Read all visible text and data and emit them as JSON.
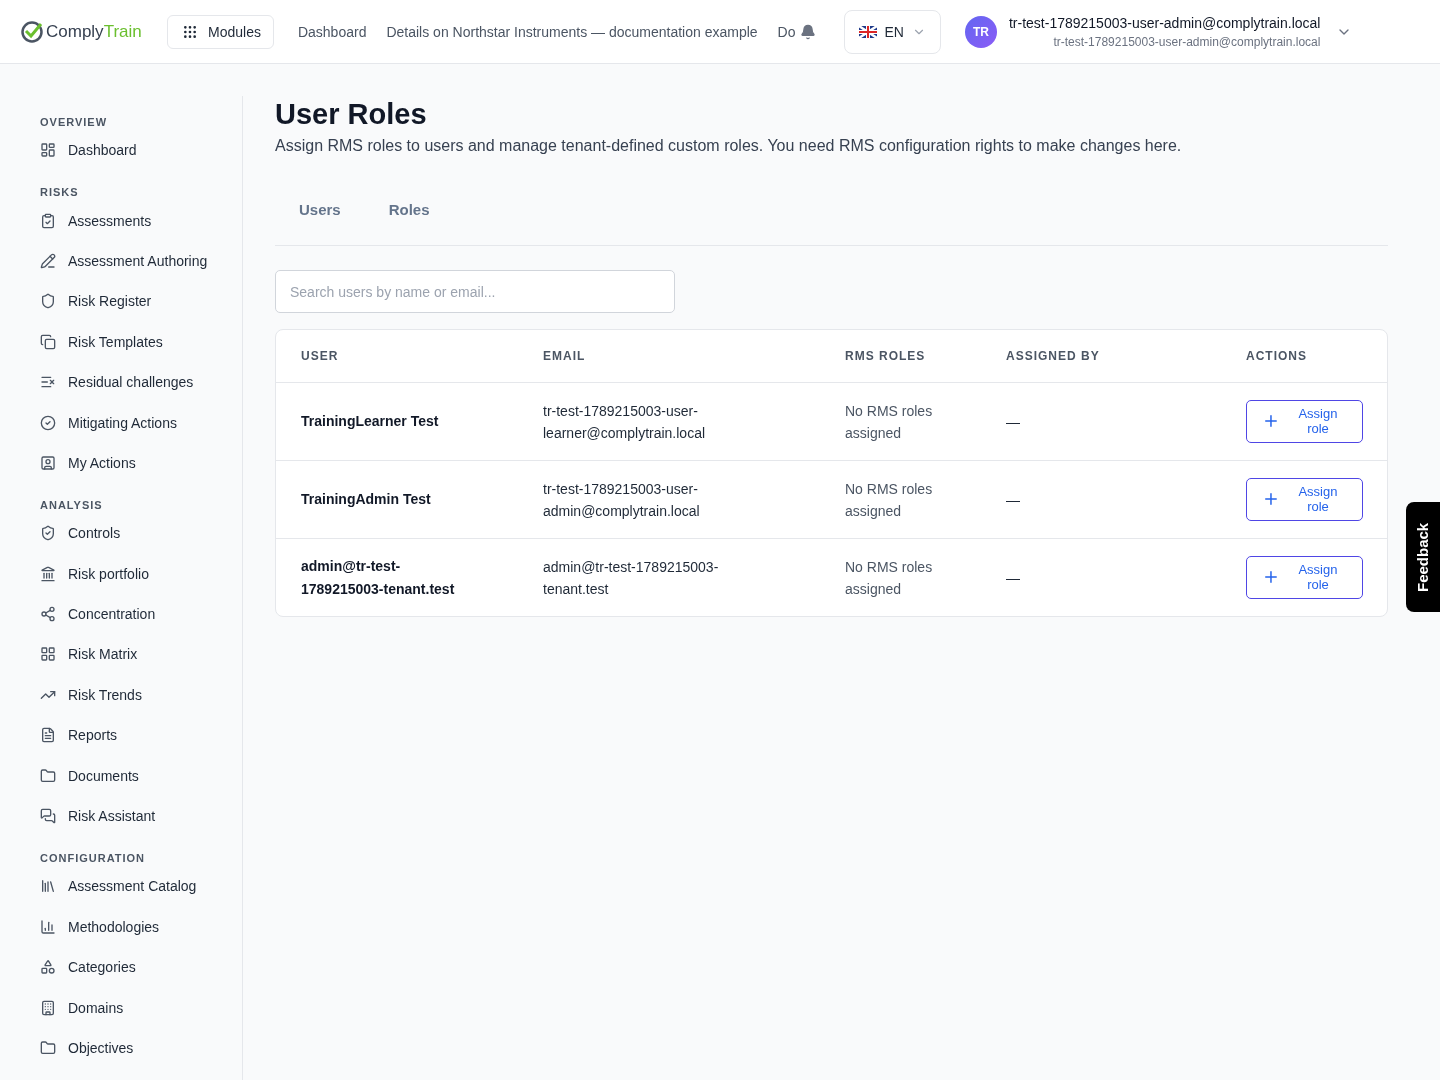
{
  "header": {
    "logo": {
      "part_1": "Comply",
      "part_2": "Train"
    },
    "modules_button": "Modules",
    "nav": [
      "Dashboard",
      "Details on Northstar Instruments — documentation example",
      "Do"
    ],
    "language": "EN",
    "user": {
      "initials": "TR",
      "name": "tr-test-1789215003-user-admin@complytrain.local",
      "email": "tr-test-1789215003-user-admin@complytrain.local"
    }
  },
  "sidebar": {
    "sections": [
      {
        "title": "OVERVIEW",
        "items": [
          "Dashboard"
        ]
      },
      {
        "title": "RISKS",
        "items": [
          "Assessments",
          "Assessment Authoring",
          "Risk Register",
          "Risk Templates",
          "Residual challenges",
          "Mitigating Actions",
          "My Actions"
        ]
      },
      {
        "title": "ANALYSIS",
        "items": [
          "Controls",
          "Risk portfolio",
          "Concentration",
          "Risk Matrix",
          "Risk Trends",
          "Reports",
          "Documents",
          "Risk Assistant"
        ]
      },
      {
        "title": "CONFIGURATION",
        "items": [
          "Assessment Catalog",
          "Methodologies",
          "Categories",
          "Domains",
          "Objectives"
        ]
      }
    ]
  },
  "page": {
    "title": "User Roles",
    "subtitle": "Assign RMS roles to users and manage tenant-defined custom roles. You need RMS configuration rights to make changes here."
  },
  "tabs": [
    {
      "label": "Users",
      "selected": false
    },
    {
      "label": "Roles",
      "selected": false
    }
  ],
  "search": {
    "placeholder": "Search users by name or email..."
  },
  "table": {
    "columns": [
      "USER",
      "EMAIL",
      "RMS ROLES",
      "ASSIGNED BY",
      "ACTIONS"
    ],
    "rows": [
      {
        "user": "TrainingLearner Test",
        "email": "tr-test-1789215003-user-learner@complytrain.local",
        "roles": "No RMS roles assigned",
        "assigned_by": "—",
        "action": "Assign role"
      },
      {
        "user": "TrainingAdmin Test",
        "email": "tr-test-1789215003-user-admin@complytrain.local",
        "roles": "No RMS roles assigned",
        "assigned_by": "—",
        "action": "Assign role"
      },
      {
        "user": "admin@tr-test-1789215003-tenant.test",
        "email": "admin@tr-test-1789215003-tenant.test",
        "roles": "No RMS roles assigned",
        "assigned_by": "—",
        "action": "Assign role"
      }
    ]
  },
  "feedback": "Feedback"
}
